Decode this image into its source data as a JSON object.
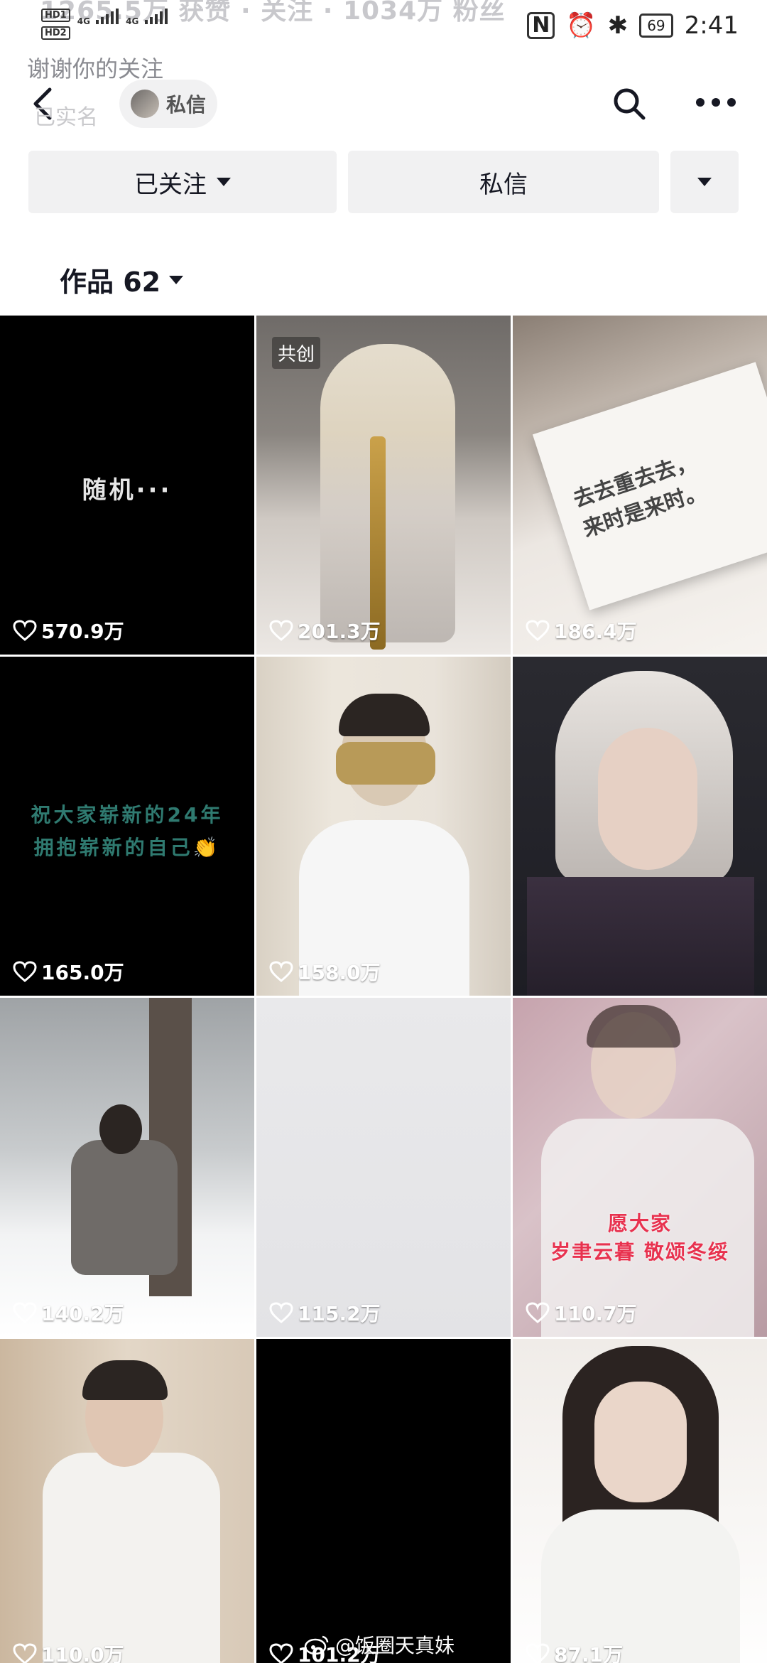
{
  "status_bar": {
    "hd_labels": [
      "HD1",
      "HD2"
    ],
    "network": [
      "4G",
      "4G"
    ],
    "battery": "69",
    "time": "2:41",
    "faded_stats": "1265.5万 获赞 · 关注 · 1034万 粉丝"
  },
  "header": {
    "thanks_text": "谢谢你的关注",
    "real_name_text": "已实名",
    "pm_pill_label": "私信"
  },
  "actions": {
    "follow_label": "已关注",
    "message_label": "私信"
  },
  "works": {
    "label": "作品 62"
  },
  "grid": [
    {
      "likes": "570.9万",
      "text": "随机···"
    },
    {
      "likes": "201.3万",
      "badge": "共创"
    },
    {
      "likes": "186.4万",
      "text_lines": [
        "去去重去去，",
        "来时是来时。"
      ]
    },
    {
      "likes": "165.0万",
      "text_lines": [
        "祝大家崭新的24年",
        "拥抱崭新的自己👏"
      ]
    },
    {
      "likes": "158.0万"
    },
    {
      "likes": ""
    },
    {
      "likes": "140.2万"
    },
    {
      "likes": "115.2万"
    },
    {
      "likes": "110.7万",
      "text_lines": [
        "愿大家",
        "岁聿云暮 敬颂冬绥"
      ]
    },
    {
      "likes": "110.0万"
    },
    {
      "likes": "101.2万"
    },
    {
      "likes": "87.1万"
    }
  ],
  "watermark": "@饭圈天真妹"
}
